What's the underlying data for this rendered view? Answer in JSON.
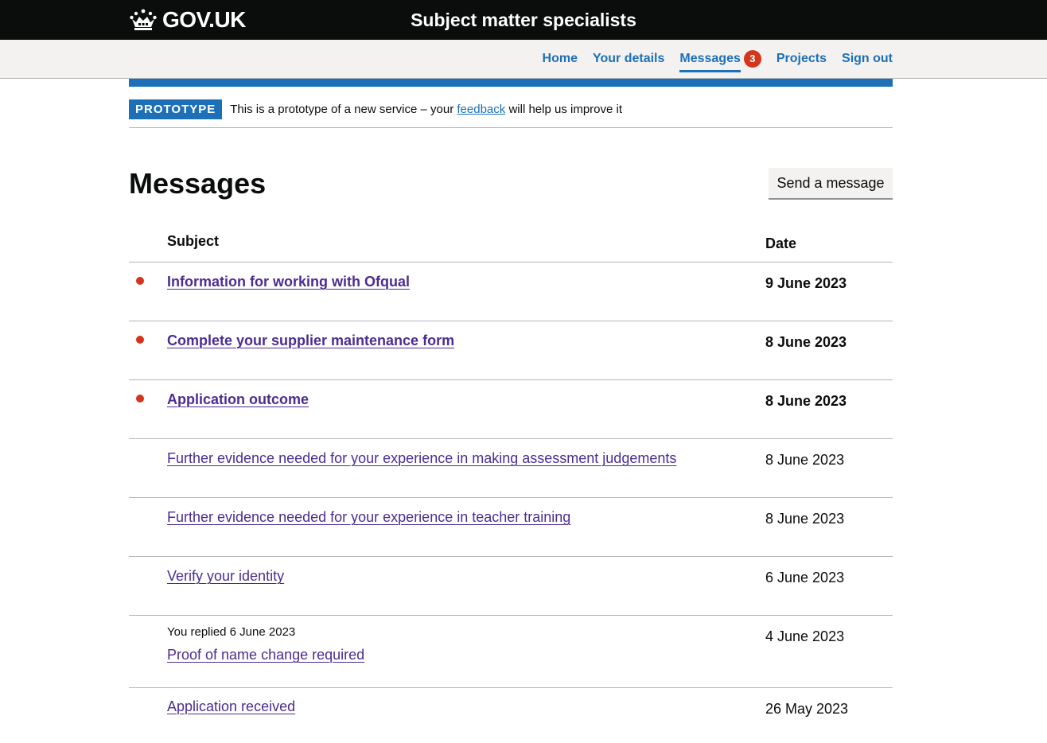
{
  "header": {
    "logo_text": "GOV.UK",
    "service_name": "Subject matter specialists"
  },
  "nav": {
    "items": [
      {
        "label": "Home"
      },
      {
        "label": "Your details"
      },
      {
        "label": "Messages",
        "badge": "3",
        "active": true
      },
      {
        "label": "Projects"
      },
      {
        "label": "Sign out"
      }
    ]
  },
  "phase_banner": {
    "tag": "PROTOTYPE",
    "text_before": "This is a prototype of a new service – your",
    "link_text": "feedback",
    "text_after": "will help us improve it"
  },
  "page": {
    "title": "Messages",
    "send_button": "Send a message"
  },
  "table": {
    "headers": {
      "subject": "Subject",
      "date": "Date"
    },
    "rows": [
      {
        "subject": "Information for working with Ofqual",
        "date": "9 June 2023",
        "unread": true,
        "note": ""
      },
      {
        "subject": "Complete your supplier maintenance form",
        "date": "8 June 2023",
        "unread": true,
        "note": ""
      },
      {
        "subject": "Application outcome",
        "date": "8 June 2023",
        "unread": true,
        "note": ""
      },
      {
        "subject": "Further evidence needed for your experience in making assessment judgements",
        "date": "8 June 2023",
        "unread": false,
        "note": ""
      },
      {
        "subject": "Further evidence needed for your experience in teacher training",
        "date": "8 June 2023",
        "unread": false,
        "note": ""
      },
      {
        "subject": "Verify your identity",
        "date": "6 June 2023",
        "unread": false,
        "note": ""
      },
      {
        "subject": "Proof of name change required",
        "date": "4 June 2023",
        "unread": false,
        "note": "You replied 6 June 2023"
      },
      {
        "subject": "Application received",
        "date": "26 May 2023",
        "unread": false,
        "note": ""
      }
    ]
  },
  "colors": {
    "header_bg": "#0b0c0c",
    "link": "#1d70b8",
    "visited_link": "#4c2c92",
    "unread_dot": "#d4351c",
    "badge": "#d4351c"
  }
}
